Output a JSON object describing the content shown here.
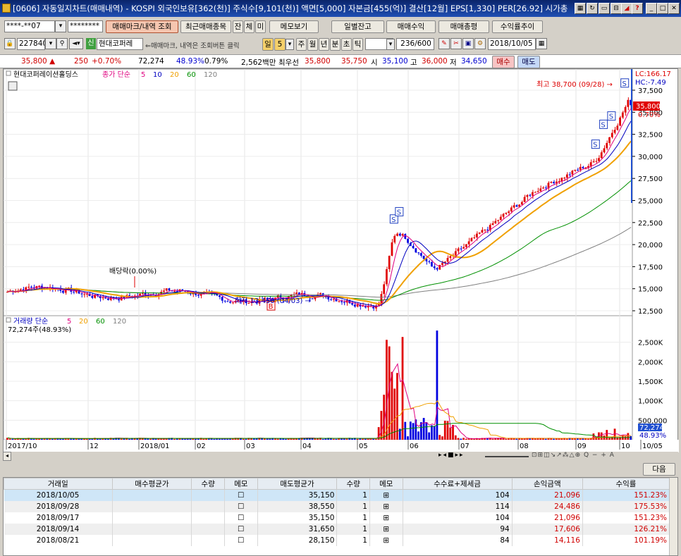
{
  "window": {
    "title": "[0606] 자동일지차트(매매내역) - KOSPI 외국인보유[362(천)] 주식수[9,101(천)] 액면[5,000] 자본금[455(억)] 결산[12월] EPS[1,330] PER[26.92] 시가총"
  },
  "toolbar1": {
    "account": "****-**07",
    "password": "********",
    "btn_mark": "매매마크/내역 조회",
    "btn_recent": "최근매매종목",
    "btn_jan": "잔",
    "btn_che": "체",
    "btn_mi": "미",
    "btn_memo": "메모보기",
    "btn_daily": "일별잔고",
    "btn_profit": "매매수익",
    "btn_total": "매매총평",
    "btn_trend": "수익률추이"
  },
  "toolbar2": {
    "code": "227840",
    "badge": "신",
    "name": "현대코퍼레",
    "hint": "매매마크, 내역은 조회버튼 클릭",
    "period_il": "일",
    "period_num": "5",
    "period_ju": "주",
    "period_wol": "월",
    "period_nyeon": "년",
    "period_bun": "분",
    "period_cho": "초",
    "period_tick": "틱",
    "count": "236",
    "count_max": "/600",
    "date": "2018/10/05"
  },
  "quote": {
    "price": "35,800 ▲",
    "change": "250",
    "pct": "+0.70%",
    "volume": "72,274",
    "vol_pct": "48.93%",
    "turnover": "0.79%",
    "amount": "2,562백만",
    "best_label": "최우선",
    "best_ask": "35,800",
    "best_bid": "35,750",
    "open_label": "시",
    "open": "35,100",
    "high_label": "고",
    "high": "36,000",
    "low_label": "저",
    "low": "34,650",
    "buy": "매수",
    "sell": "매도"
  },
  "chart": {
    "legend_name": "현대코퍼레이션홀딩스",
    "legend_ma": "종가 단순",
    "ma": [
      "5",
      "10",
      "20",
      "60",
      "120"
    ],
    "lc": "LC:166.17",
    "hc": "HC:-7.49",
    "price_ticks": [
      "37,500",
      "35,000",
      "32,500",
      "30,000",
      "27,500",
      "25,000",
      "22,500",
      "20,000",
      "17,500",
      "15,000",
      "12,500"
    ],
    "cur_price": "35,800",
    "cur_pct": "0.70%",
    "ann_high": "최고 38,700 (09/28) →",
    "ann_low": "최저 13,450 (04/03) →",
    "ann_div": "배당락(0.00%)",
    "vol_legend": "거래량 단순",
    "vol_ma": [
      "5",
      "20",
      "60",
      "120"
    ],
    "vol_info": "72,274주(48.93%)",
    "vol_ticks": [
      "2,500K",
      "2,000K",
      "1,500K",
      "1,000K",
      "500,000"
    ],
    "vol_cur": "72,274",
    "vol_cur2": "48.93%",
    "x_labels": [
      "2017/10",
      "12",
      "2018/01",
      "02",
      "03",
      "04",
      "05",
      "06",
      "07",
      "08",
      "09",
      "10",
      "10/05"
    ],
    "colors": {
      "up": "#e00000",
      "down": "#0000e0",
      "ma5": "#e0007f",
      "ma10": "#0000c0",
      "ma20": "#f0a000",
      "ma60": "#009000",
      "ma120": "#808080"
    }
  },
  "next_button": "다음",
  "table": {
    "headers": [
      "거래일",
      "매수평균가",
      "수량",
      "메모",
      "매도평균가",
      "수량",
      "메모",
      "수수료+제세금",
      "손익금액",
      "수익률"
    ],
    "rows": [
      {
        "date": "2018/10/05",
        "sell": "35,150",
        "qty": "1",
        "fee": "104",
        "pnl": "21,096",
        "rate": "151.23%"
      },
      {
        "date": "2018/09/28",
        "sell": "38,550",
        "qty": "1",
        "fee": "114",
        "pnl": "24,486",
        "rate": "175.53%"
      },
      {
        "date": "2018/09/17",
        "sell": "35,150",
        "qty": "1",
        "fee": "104",
        "pnl": "21,096",
        "rate": "151.23%"
      },
      {
        "date": "2018/09/14",
        "sell": "31,650",
        "qty": "1",
        "fee": "94",
        "pnl": "17,606",
        "rate": "126.21%"
      },
      {
        "date": "2018/08/21",
        "sell": "28,150",
        "qty": "1",
        "fee": "84",
        "pnl": "14,116",
        "rate": "101.19%"
      }
    ]
  }
}
